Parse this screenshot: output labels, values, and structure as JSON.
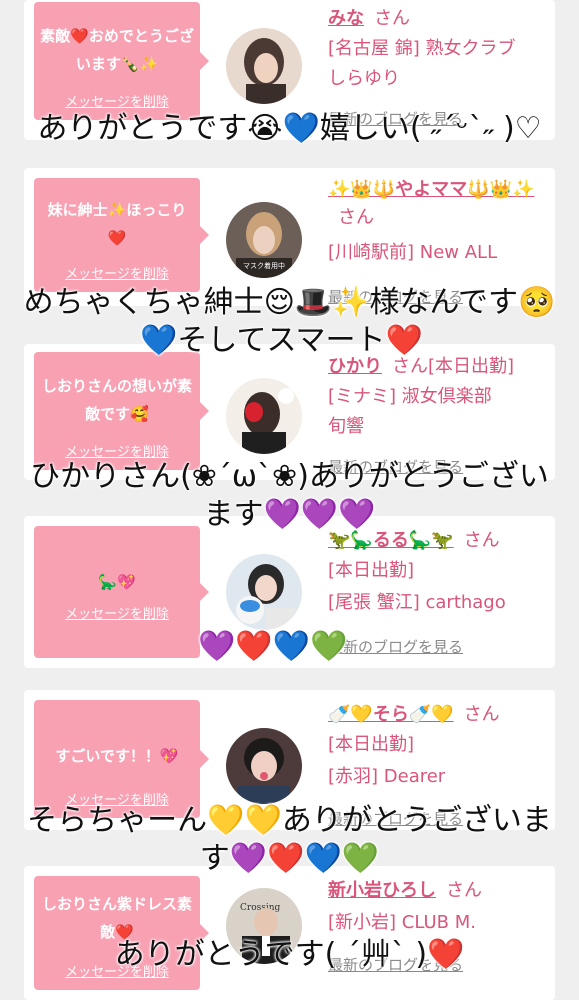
{
  "cards": [
    {
      "message": "素敵❤️おめでとうございます🍾✨",
      "delete": "メッセージを削除",
      "name": "みな",
      "san": "さん",
      "lines": [
        "[名古屋 錦] 熟女クラブ",
        "しらゆり"
      ],
      "blog": "最新のブログを見る"
    },
    {
      "message": "妹に紳士✨ほっこり❤️",
      "delete": "メッセージを削除",
      "name": "✨👑🔱やよママ🔱👑✨",
      "san": "さん",
      "lines": [
        "[川崎駅前] New ALL"
      ],
      "blog": "最新のブログを見る"
    },
    {
      "message": "しおりさんの想いが素敵です🥰",
      "delete": "メッセージを削除",
      "name": "ひかり",
      "san": "さん[本日出勤]",
      "lines": [
        "[ミナミ] 淑女倶楽部",
        "旬響"
      ],
      "blog": "最新のブログを見る"
    },
    {
      "message": "🦕💖",
      "delete": "メッセージを削除",
      "name": "🦖🦕るる🦕🦖",
      "san": "さん",
      "lines": [
        "[本日出勤]",
        "[尾張 蟹江] carthago"
      ],
      "blog": "最新のブログを見る"
    },
    {
      "message": "すごいです！！💖",
      "delete": "メッセージを削除",
      "name": "🍼💛そら🍼💛",
      "san": "さん",
      "lines": [
        "[本日出勤]",
        "[赤羽] Dearer"
      ],
      "blog": "最新のブログを見る"
    },
    {
      "message": "しおりさん紫ドレス素敵❤️",
      "delete": "メッセージを削除",
      "name": "新小岩ひろし",
      "san": "さん",
      "lines": [
        "[新小岩] CLUB M."
      ],
      "blog": "最新のブログを見る"
    }
  ],
  "captions": [
    "ありがとうです😭💙嬉しい( ˶ˊᵕˋ˶ )♡",
    "めちゃくちゃ紳士😌🎩✨様なんです🥺",
    "💙そしてスマート❤️",
    "ひかりさん(❀´ω`❀)ありがとうござい",
    "ます💜💜💜",
    "💜❤️💙💚",
    "そらちゃーん💛💛ありがとうございま",
    "す💜❤️💙💚",
    "ありがとうです( ´艸` )❤️"
  ],
  "colors": {
    "bubble": "#f7a1b3",
    "name": "#d9557a",
    "link": "#8a8a8a",
    "background": "#efefef"
  }
}
